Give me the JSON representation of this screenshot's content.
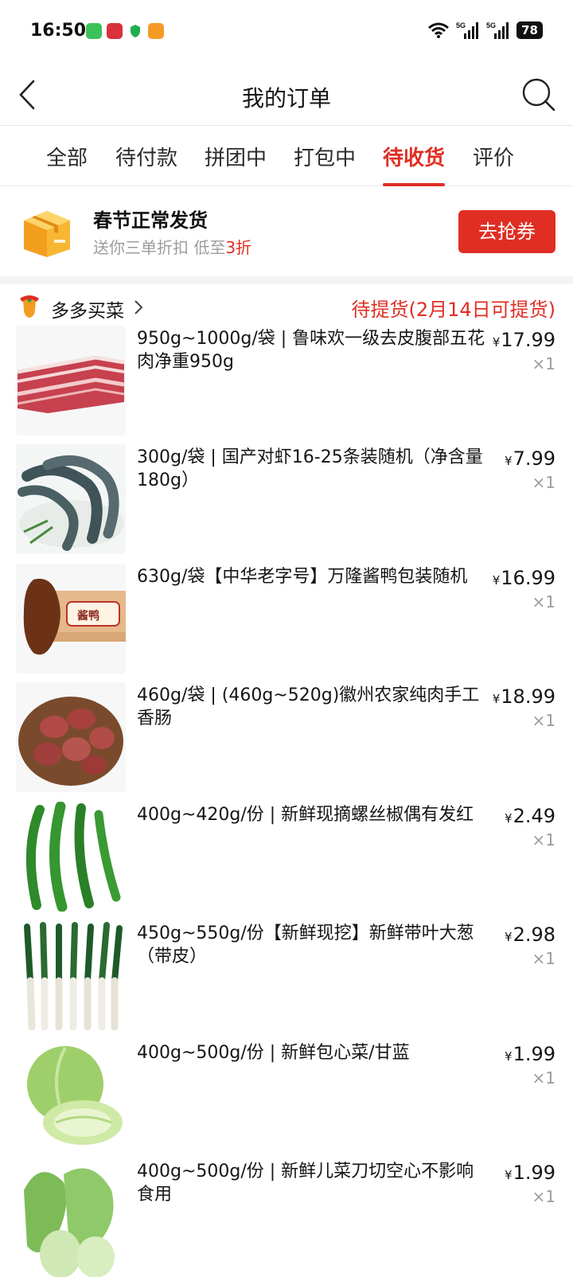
{
  "status_bar": {
    "time": "16:50",
    "battery": "78",
    "network_label": "5G"
  },
  "nav": {
    "title": "我的订单"
  },
  "tabs": [
    {
      "label": "全部",
      "active": false
    },
    {
      "label": "待付款",
      "active": false
    },
    {
      "label": "拼团中",
      "active": false
    },
    {
      "label": "打包中",
      "active": false
    },
    {
      "label": "待收货",
      "active": true
    },
    {
      "label": "评价",
      "active": false
    }
  ],
  "banner": {
    "title": "春节正常发货",
    "subtitle_prefix": "送你三单折扣 低至",
    "subtitle_highlight": "3折",
    "button_label": "去抢券"
  },
  "store": {
    "name": "多多买菜",
    "status": "待提货(2月14日可提货)"
  },
  "currency_symbol": "¥",
  "items": [
    {
      "title": "950g~1000g/袋 | 鲁味欢一级去皮腹部五花肉净重950g",
      "price": "17.99",
      "qty": "×1",
      "icon": "pork-belly-image"
    },
    {
      "title": "300g/袋 | 国产对虾16-25条装随机（净含量180g）",
      "price": "7.99",
      "qty": "×1",
      "icon": "shrimp-image"
    },
    {
      "title": "630g/袋【中华老字号】万隆酱鸭包装随机",
      "price": "16.99",
      "qty": "×1",
      "icon": "duck-image",
      "image_text": "酱鸭"
    },
    {
      "title": "460g/袋 | (460g~520g)徽州农家纯肉手工香肠",
      "price": "18.99",
      "qty": "×1",
      "icon": "sausage-image"
    },
    {
      "title": "400g~420g/份 | 新鲜现摘螺丝椒偶有发红",
      "price": "2.49",
      "qty": "×1",
      "icon": "pepper-image"
    },
    {
      "title": "450g~550g/份【新鲜现挖】新鲜带叶大葱（带皮）",
      "price": "2.98",
      "qty": "×1",
      "icon": "scallion-image"
    },
    {
      "title": "400g~500g/份 | 新鲜包心菜/甘蓝",
      "price": "1.99",
      "qty": "×1",
      "icon": "cabbage-image"
    },
    {
      "title": "400g~500g/份 | 新鲜儿菜刀切空心不影响食用",
      "price": "1.99",
      "qty": "×1",
      "icon": "erchai-image"
    }
  ],
  "colors": {
    "accent": "#e02e24",
    "muted": "#9c9c9c"
  }
}
